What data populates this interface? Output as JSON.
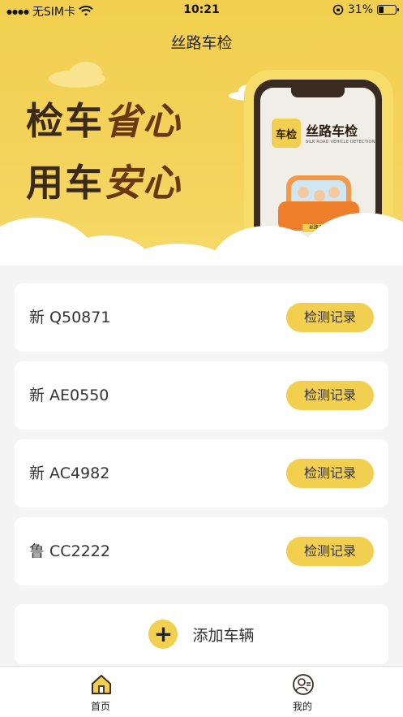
{
  "status_bar": {
    "carrier": "无SIM卡",
    "time": "10:21",
    "battery_percent": "31%",
    "battery_level": 0.31
  },
  "header": {
    "title": "丝路车检"
  },
  "banner": {
    "slogan_line1_a": "检车",
    "slogan_line1_b": "省心",
    "slogan_line2_a": "用车",
    "slogan_line2_b": "安心",
    "phone_badge": "车检",
    "phone_app_name": "丝路车检",
    "phone_app_subtitle": "SILK ROAD VEHICLE DETECTION",
    "phone_car_plate": "丝路车检"
  },
  "vehicles": [
    {
      "plate": "新 Q50871",
      "button": "检测记录"
    },
    {
      "plate": "新 AE0550",
      "button": "检测记录"
    },
    {
      "plate": "新 AC4982",
      "button": "检测记录"
    },
    {
      "plate": "鲁 CC2222",
      "button": "检测记录"
    }
  ],
  "add_vehicle": {
    "label": "添加车辆",
    "icon": "plus-icon"
  },
  "tabbar": {
    "home_label": "首页",
    "home_icon": "home-icon",
    "mine_label": "我的",
    "mine_icon": "user-icon"
  },
  "colors": {
    "accent": "#f2cf4e",
    "slogan_dark": "#3b2a1a",
    "slogan_brown": "#6a3814"
  }
}
